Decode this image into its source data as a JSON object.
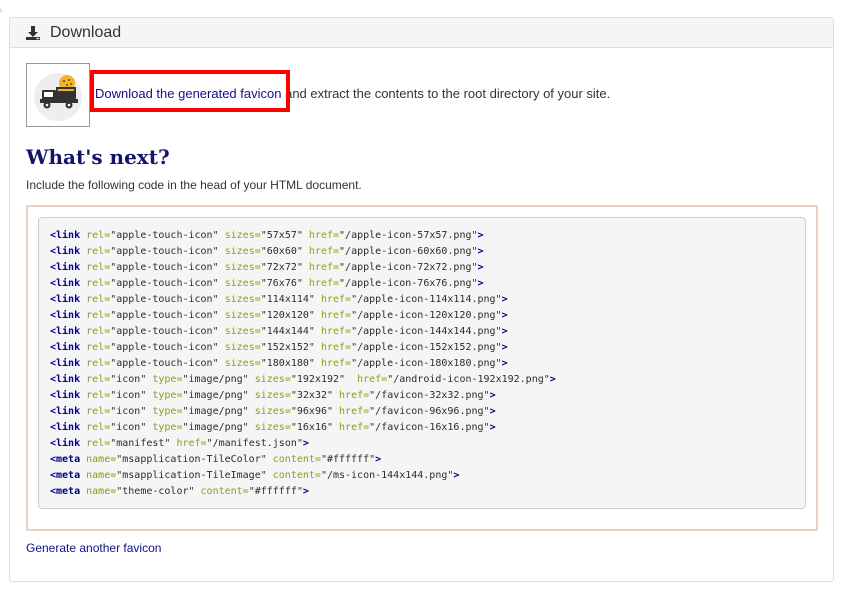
{
  "header": {
    "title": "Download",
    "icon": "download-icon"
  },
  "thumbnail": {
    "icon": "truck-icon",
    "alt_icon": "favicon-preview-icon"
  },
  "download": {
    "link_label": "Download the generated favicon",
    "rest_text": "and extract the contents to the root directory of your site."
  },
  "next": {
    "heading": "What's next?",
    "instructions": "Include the following code in the head of your HTML document."
  },
  "code_lines": [
    [
      {
        "c": "tag",
        "t": "<link"
      },
      {
        "c": "attr",
        "t": " rel="
      },
      {
        "c": "val",
        "t": "\"apple-touch-icon\""
      },
      {
        "c": "attr",
        "t": " sizes="
      },
      {
        "c": "val",
        "t": "\"57x57\""
      },
      {
        "c": "attr",
        "t": " href="
      },
      {
        "c": "val",
        "t": "\"/apple-icon-57x57.png\""
      },
      {
        "c": "tag",
        "t": ">"
      }
    ],
    [
      {
        "c": "tag",
        "t": "<link"
      },
      {
        "c": "attr",
        "t": " rel="
      },
      {
        "c": "val",
        "t": "\"apple-touch-icon\""
      },
      {
        "c": "attr",
        "t": " sizes="
      },
      {
        "c": "val",
        "t": "\"60x60\""
      },
      {
        "c": "attr",
        "t": " href="
      },
      {
        "c": "val",
        "t": "\"/apple-icon-60x60.png\""
      },
      {
        "c": "tag",
        "t": ">"
      }
    ],
    [
      {
        "c": "tag",
        "t": "<link"
      },
      {
        "c": "attr",
        "t": " rel="
      },
      {
        "c": "val",
        "t": "\"apple-touch-icon\""
      },
      {
        "c": "attr",
        "t": " sizes="
      },
      {
        "c": "val",
        "t": "\"72x72\""
      },
      {
        "c": "attr",
        "t": " href="
      },
      {
        "c": "val",
        "t": "\"/apple-icon-72x72.png\""
      },
      {
        "c": "tag",
        "t": ">"
      }
    ],
    [
      {
        "c": "tag",
        "t": "<link"
      },
      {
        "c": "attr",
        "t": " rel="
      },
      {
        "c": "val",
        "t": "\"apple-touch-icon\""
      },
      {
        "c": "attr",
        "t": " sizes="
      },
      {
        "c": "val",
        "t": "\"76x76\""
      },
      {
        "c": "attr",
        "t": " href="
      },
      {
        "c": "val",
        "t": "\"/apple-icon-76x76.png\""
      },
      {
        "c": "tag",
        "t": ">"
      }
    ],
    [
      {
        "c": "tag",
        "t": "<link"
      },
      {
        "c": "attr",
        "t": " rel="
      },
      {
        "c": "val",
        "t": "\"apple-touch-icon\""
      },
      {
        "c": "attr",
        "t": " sizes="
      },
      {
        "c": "val",
        "t": "\"114x114\""
      },
      {
        "c": "attr",
        "t": " href="
      },
      {
        "c": "val",
        "t": "\"/apple-icon-114x114.png\""
      },
      {
        "c": "tag",
        "t": ">"
      }
    ],
    [
      {
        "c": "tag",
        "t": "<link"
      },
      {
        "c": "attr",
        "t": " rel="
      },
      {
        "c": "val",
        "t": "\"apple-touch-icon\""
      },
      {
        "c": "attr",
        "t": " sizes="
      },
      {
        "c": "val",
        "t": "\"120x120\""
      },
      {
        "c": "attr",
        "t": " href="
      },
      {
        "c": "val",
        "t": "\"/apple-icon-120x120.png\""
      },
      {
        "c": "tag",
        "t": ">"
      }
    ],
    [
      {
        "c": "tag",
        "t": "<link"
      },
      {
        "c": "attr",
        "t": " rel="
      },
      {
        "c": "val",
        "t": "\"apple-touch-icon\""
      },
      {
        "c": "attr",
        "t": " sizes="
      },
      {
        "c": "val",
        "t": "\"144x144\""
      },
      {
        "c": "attr",
        "t": " href="
      },
      {
        "c": "val",
        "t": "\"/apple-icon-144x144.png\""
      },
      {
        "c": "tag",
        "t": ">"
      }
    ],
    [
      {
        "c": "tag",
        "t": "<link"
      },
      {
        "c": "attr",
        "t": " rel="
      },
      {
        "c": "val",
        "t": "\"apple-touch-icon\""
      },
      {
        "c": "attr",
        "t": " sizes="
      },
      {
        "c": "val",
        "t": "\"152x152\""
      },
      {
        "c": "attr",
        "t": " href="
      },
      {
        "c": "val",
        "t": "\"/apple-icon-152x152.png\""
      },
      {
        "c": "tag",
        "t": ">"
      }
    ],
    [
      {
        "c": "tag",
        "t": "<link"
      },
      {
        "c": "attr",
        "t": " rel="
      },
      {
        "c": "val",
        "t": "\"apple-touch-icon\""
      },
      {
        "c": "attr",
        "t": " sizes="
      },
      {
        "c": "val",
        "t": "\"180x180\""
      },
      {
        "c": "attr",
        "t": " href="
      },
      {
        "c": "val",
        "t": "\"/apple-icon-180x180.png\""
      },
      {
        "c": "tag",
        "t": ">"
      }
    ],
    [
      {
        "c": "tag",
        "t": "<link"
      },
      {
        "c": "attr",
        "t": " rel="
      },
      {
        "c": "val",
        "t": "\"icon\""
      },
      {
        "c": "attr",
        "t": " type="
      },
      {
        "c": "val",
        "t": "\"image/png\""
      },
      {
        "c": "attr",
        "t": " sizes="
      },
      {
        "c": "val",
        "t": "\"192x192\""
      },
      {
        "c": "attr",
        "t": "  href="
      },
      {
        "c": "val",
        "t": "\"/android-icon-192x192.png\""
      },
      {
        "c": "tag",
        "t": ">"
      }
    ],
    [
      {
        "c": "tag",
        "t": "<link"
      },
      {
        "c": "attr",
        "t": " rel="
      },
      {
        "c": "val",
        "t": "\"icon\""
      },
      {
        "c": "attr",
        "t": " type="
      },
      {
        "c": "val",
        "t": "\"image/png\""
      },
      {
        "c": "attr",
        "t": " sizes="
      },
      {
        "c": "val",
        "t": "\"32x32\""
      },
      {
        "c": "attr",
        "t": " href="
      },
      {
        "c": "val",
        "t": "\"/favicon-32x32.png\""
      },
      {
        "c": "tag",
        "t": ">"
      }
    ],
    [
      {
        "c": "tag",
        "t": "<link"
      },
      {
        "c": "attr",
        "t": " rel="
      },
      {
        "c": "val",
        "t": "\"icon\""
      },
      {
        "c": "attr",
        "t": " type="
      },
      {
        "c": "val",
        "t": "\"image/png\""
      },
      {
        "c": "attr",
        "t": " sizes="
      },
      {
        "c": "val",
        "t": "\"96x96\""
      },
      {
        "c": "attr",
        "t": " href="
      },
      {
        "c": "val",
        "t": "\"/favicon-96x96.png\""
      },
      {
        "c": "tag",
        "t": ">"
      }
    ],
    [
      {
        "c": "tag",
        "t": "<link"
      },
      {
        "c": "attr",
        "t": " rel="
      },
      {
        "c": "val",
        "t": "\"icon\""
      },
      {
        "c": "attr",
        "t": " type="
      },
      {
        "c": "val",
        "t": "\"image/png\""
      },
      {
        "c": "attr",
        "t": " sizes="
      },
      {
        "c": "val",
        "t": "\"16x16\""
      },
      {
        "c": "attr",
        "t": " href="
      },
      {
        "c": "val",
        "t": "\"/favicon-16x16.png\""
      },
      {
        "c": "tag",
        "t": ">"
      }
    ],
    [
      {
        "c": "tag",
        "t": "<link"
      },
      {
        "c": "attr",
        "t": " rel="
      },
      {
        "c": "val",
        "t": "\"manifest\""
      },
      {
        "c": "attr",
        "t": " href="
      },
      {
        "c": "val",
        "t": "\"/manifest.json\""
      },
      {
        "c": "tag",
        "t": ">"
      }
    ],
    [
      {
        "c": "tag",
        "t": "<meta"
      },
      {
        "c": "attr",
        "t": " name="
      },
      {
        "c": "val",
        "t": "\"msapplication-TileColor\""
      },
      {
        "c": "attr",
        "t": " content="
      },
      {
        "c": "val",
        "t": "\"#ffffff\""
      },
      {
        "c": "tag",
        "t": ">"
      }
    ],
    [
      {
        "c": "tag",
        "t": "<meta"
      },
      {
        "c": "attr",
        "t": " name="
      },
      {
        "c": "val",
        "t": "\"msapplication-TileImage\""
      },
      {
        "c": "attr",
        "t": " content="
      },
      {
        "c": "val",
        "t": "\"/ms-icon-144x144.png\""
      },
      {
        "c": "tag",
        "t": ">"
      }
    ],
    [
      {
        "c": "tag",
        "t": "<meta"
      },
      {
        "c": "attr",
        "t": " name="
      },
      {
        "c": "val",
        "t": "\"theme-color\""
      },
      {
        "c": "attr",
        "t": " content="
      },
      {
        "c": "val",
        "t": "\"#ffffff\""
      },
      {
        "c": "tag",
        "t": ">"
      }
    ]
  ],
  "footer": {
    "generate_link": "Generate another favicon"
  },
  "colors": {
    "link": "#11118a",
    "heading": "#14146b",
    "highlight": "#ff0000",
    "code_tag": "#00008b",
    "code_attr": "#87a01e",
    "frame_border": "#e8d2c6"
  }
}
